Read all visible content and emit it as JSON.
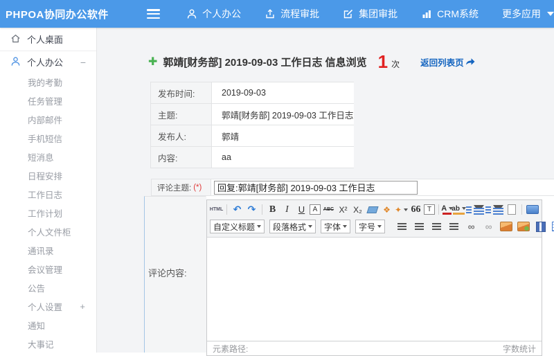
{
  "colors": {
    "topbar": "#4b99e8",
    "accent_blue": "#4a90e2",
    "link_blue": "#1565c0",
    "count_red": "#e12222",
    "plus_green": "#49b252"
  },
  "header": {
    "logo": "PHPOA协同办公软件",
    "nav": [
      {
        "name": "personal-office",
        "icon": "person-icon",
        "label": "个人办公"
      },
      {
        "name": "workflow-approval",
        "icon": "flow-approval-icon",
        "label": "流程审批"
      },
      {
        "name": "group-approval",
        "icon": "edit-square-icon",
        "label": "集团审批"
      },
      {
        "name": "crm-system",
        "icon": "bar-chart-icon",
        "label": "CRM系统"
      },
      {
        "name": "more-apps",
        "icon": "caret-down-icon",
        "label": "更多应用"
      }
    ]
  },
  "sidebar": {
    "desktop": {
      "label": "个人桌面",
      "icon": "home-icon"
    },
    "group": {
      "label": "个人办公",
      "icon": "user-icon",
      "toggle": "−"
    },
    "items": [
      {
        "label": "我的考勤"
      },
      {
        "label": "任务管理"
      },
      {
        "label": "内部邮件"
      },
      {
        "label": "手机短信"
      },
      {
        "label": "短消息"
      },
      {
        "label": "日程安排"
      },
      {
        "label": "工作日志"
      },
      {
        "label": "工作计划"
      },
      {
        "label": "个人文件柜"
      },
      {
        "label": "通讯录"
      },
      {
        "label": "会议管理"
      },
      {
        "label": "公告"
      },
      {
        "label": "个人设置",
        "toggle": "+"
      },
      {
        "label": "通知"
      },
      {
        "label": "大事记"
      }
    ]
  },
  "main": {
    "title": {
      "plus_glyph": "✚",
      "text": "郭靖[财务部] 2019-09-03 工作日志 信息浏览",
      "count": "1",
      "count_unit": "次",
      "back_label": "返回列表页"
    },
    "info_rows": [
      {
        "label": "发布时间:",
        "value": "2019-09-03"
      },
      {
        "label": "主题:",
        "value": "郭靖[财务部] 2019-09-03 工作日志"
      },
      {
        "label": "发布人:",
        "value": "郭靖"
      },
      {
        "label": "内容:",
        "value": "aa"
      }
    ],
    "comment": {
      "subject_label": "评论主题:",
      "required_mark": "(*)",
      "subject_value": "回复:郭靖[财务部] 2019-09-03 工作日志",
      "content_label": "评论内容:"
    }
  },
  "editor": {
    "toolbar_row1": [
      {
        "name": "source-code-button",
        "glyph": "HTML",
        "cls": "t-html"
      },
      {
        "name": "toolbar-separator",
        "cls": "t-sep"
      },
      {
        "name": "undo-icon",
        "glyph": "↶",
        "cls": "t-blue"
      },
      {
        "name": "redo-icon",
        "glyph": "↷",
        "cls": "t-blue"
      },
      {
        "name": "toolbar-separator",
        "cls": "t-sep"
      },
      {
        "name": "bold-icon",
        "glyph": "B",
        "cls": "t-bold"
      },
      {
        "name": "italic-icon",
        "glyph": "I",
        "cls": "t-italic"
      },
      {
        "name": "underline-icon",
        "glyph": "U",
        "cls": "t-underline"
      },
      {
        "name": "font-style-icon",
        "glyph": "A",
        "cls": "t-boxed"
      },
      {
        "name": "strikethrough-icon",
        "glyph": "ABC",
        "cls": "t-strike"
      },
      {
        "name": "superscript-icon",
        "glyph": "X²"
      },
      {
        "name": "subscript-icon",
        "glyph": "X₂"
      },
      {
        "name": "eraser-icon",
        "cls": "t-eraser",
        "shape": true
      },
      {
        "name": "format-brush-icon",
        "glyph": "❖",
        "cls": "t-orange"
      },
      {
        "name": "quick-format-icon",
        "glyph": "✦",
        "cls": "t-orange",
        "caret": true
      },
      {
        "name": "blockquote-icon",
        "glyph": "66",
        "cls": "t-quote"
      },
      {
        "name": "paste-text-icon",
        "glyph": "T",
        "cls": "t-boxed"
      },
      {
        "name": "toolbar-separator",
        "cls": "t-sep"
      },
      {
        "name": "font-color-icon",
        "glyph": "A",
        "cls": "t-fontcolor",
        "caret": true
      },
      {
        "name": "highlight-color-icon",
        "glyph": "ab",
        "cls": "t-highlight",
        "caret": true
      },
      {
        "name": "ordered-list-icon",
        "cls": "t-list",
        "shape": true,
        "caret": true
      },
      {
        "name": "unordered-list-icon",
        "cls": "t-list",
        "shape": true,
        "caret": true
      },
      {
        "name": "new-page-icon",
        "cls": "t-page",
        "shape": true
      },
      {
        "name": "toolbar-separator",
        "cls": "t-sep"
      },
      {
        "name": "fullscreen-icon",
        "cls": "t-monitor",
        "shape": true
      }
    ],
    "toolbar_dropdowns": [
      {
        "name": "heading-select",
        "label": "自定义标题",
        "width": 86
      },
      {
        "name": "paragraph-select",
        "label": "段落格式",
        "width": 78
      },
      {
        "name": "font-family-select",
        "label": "字体",
        "width": 74
      },
      {
        "name": "font-size-select",
        "label": "字号",
        "width": 88
      }
    ],
    "toolbar_row2_icons": [
      {
        "name": "align-left-icon",
        "cls": "t-bars",
        "shape": true
      },
      {
        "name": "align-center-icon",
        "cls": "t-bars",
        "shape": true
      },
      {
        "name": "align-right-icon",
        "cls": "t-bars",
        "shape": true
      },
      {
        "name": "align-justify-icon",
        "cls": "t-bars",
        "shape": true
      },
      {
        "name": "link-icon",
        "glyph": "∞",
        "cls": "t-link"
      },
      {
        "name": "unlink-icon",
        "glyph": "∞",
        "cls": "t-link t-dim"
      },
      {
        "name": "image-icon",
        "cls": "t-img",
        "shape": true
      },
      {
        "name": "flash-icon",
        "cls": "t-img t-img2",
        "shape": true
      },
      {
        "name": "media-icon",
        "cls": "t-media",
        "shape": true
      },
      {
        "name": "table-icon",
        "cls": "t-table",
        "shape": true
      }
    ],
    "statusbar_left": "元素路径:",
    "statusbar_right": "字数统计"
  }
}
